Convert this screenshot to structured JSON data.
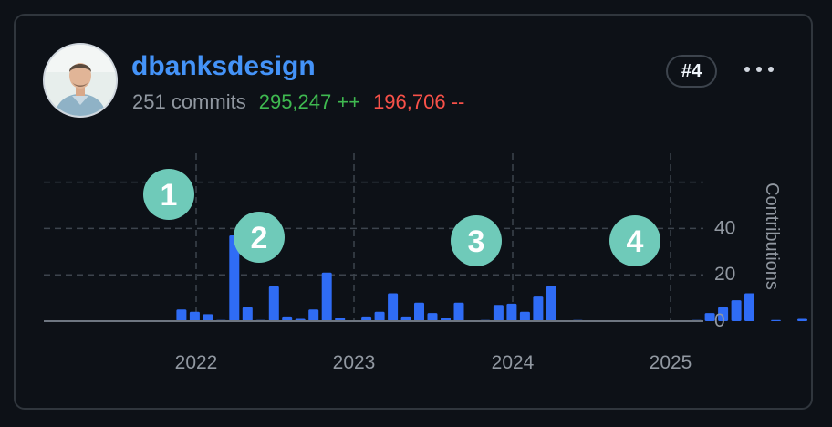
{
  "user": {
    "name": "dbanksdesign",
    "commits": "251 commits",
    "additions": "295,247 ++",
    "deletions": "196,706 --",
    "rank": "#4",
    "avatar_icon": "user-avatar-photo"
  },
  "colors": {
    "background": "#0d1117",
    "border": "#30363d",
    "accent": "#4493f8",
    "bar": "#2f6cf5",
    "additions": "#3fb950",
    "deletions": "#f85149",
    "badge": "#6fcab9"
  },
  "annotations": [
    "1",
    "2",
    "3",
    "4"
  ],
  "chart_data": {
    "type": "bar",
    "ylabel": "Contributions",
    "yticks": [
      "0",
      "20",
      "40"
    ],
    "ylim": [
      0,
      60
    ],
    "xticks": [
      "2022",
      "2023",
      "2024",
      "2025"
    ],
    "grid": true,
    "series": [
      {
        "values": [
          0,
          0,
          0,
          0,
          0,
          5,
          4,
          3,
          0.5,
          37,
          6,
          0.5,
          15,
          2,
          1,
          5,
          21,
          1.5,
          0,
          2,
          4,
          12,
          2,
          8,
          3.5,
          1.5,
          8,
          0,
          0.5,
          7,
          7.5,
          4,
          11,
          15,
          0,
          0.5,
          0,
          0,
          0,
          0,
          0,
          0,
          0,
          0,
          0.5,
          3.5,
          6,
          9,
          12,
          0,
          0.5,
          0,
          1
        ]
      }
    ]
  }
}
